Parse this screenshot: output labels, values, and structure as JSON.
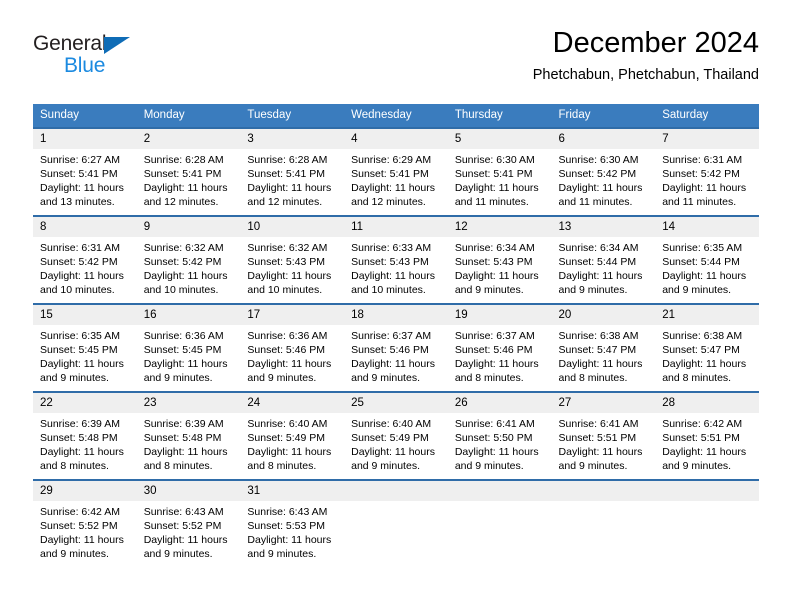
{
  "brand": {
    "name_part1": "General",
    "name_part2": "Blue",
    "accent_color": "#1b8ae0",
    "triangle_color": "#0f6cb6",
    "triangle_icon": "triangle-icon"
  },
  "header": {
    "title": "December 2024",
    "subtitle": "Phetchabun, Phetchabun, Thailand"
  },
  "calendar": {
    "header_color": "#3a7cbe",
    "row_border_color": "#2f6ca8",
    "daynum_background": "#efefef",
    "weekdays": [
      "Sunday",
      "Monday",
      "Tuesday",
      "Wednesday",
      "Thursday",
      "Friday",
      "Saturday"
    ],
    "weeks": [
      [
        {
          "day": "1",
          "sunrise": "Sunrise: 6:27 AM",
          "sunset": "Sunset: 5:41 PM",
          "daylight_line1": "Daylight: 11 hours",
          "daylight_line2": "and 13 minutes."
        },
        {
          "day": "2",
          "sunrise": "Sunrise: 6:28 AM",
          "sunset": "Sunset: 5:41 PM",
          "daylight_line1": "Daylight: 11 hours",
          "daylight_line2": "and 12 minutes."
        },
        {
          "day": "3",
          "sunrise": "Sunrise: 6:28 AM",
          "sunset": "Sunset: 5:41 PM",
          "daylight_line1": "Daylight: 11 hours",
          "daylight_line2": "and 12 minutes."
        },
        {
          "day": "4",
          "sunrise": "Sunrise: 6:29 AM",
          "sunset": "Sunset: 5:41 PM",
          "daylight_line1": "Daylight: 11 hours",
          "daylight_line2": "and 12 minutes."
        },
        {
          "day": "5",
          "sunrise": "Sunrise: 6:30 AM",
          "sunset": "Sunset: 5:41 PM",
          "daylight_line1": "Daylight: 11 hours",
          "daylight_line2": "and 11 minutes."
        },
        {
          "day": "6",
          "sunrise": "Sunrise: 6:30 AM",
          "sunset": "Sunset: 5:42 PM",
          "daylight_line1": "Daylight: 11 hours",
          "daylight_line2": "and 11 minutes."
        },
        {
          "day": "7",
          "sunrise": "Sunrise: 6:31 AM",
          "sunset": "Sunset: 5:42 PM",
          "daylight_line1": "Daylight: 11 hours",
          "daylight_line2": "and 11 minutes."
        }
      ],
      [
        {
          "day": "8",
          "sunrise": "Sunrise: 6:31 AM",
          "sunset": "Sunset: 5:42 PM",
          "daylight_line1": "Daylight: 11 hours",
          "daylight_line2": "and 10 minutes."
        },
        {
          "day": "9",
          "sunrise": "Sunrise: 6:32 AM",
          "sunset": "Sunset: 5:42 PM",
          "daylight_line1": "Daylight: 11 hours",
          "daylight_line2": "and 10 minutes."
        },
        {
          "day": "10",
          "sunrise": "Sunrise: 6:32 AM",
          "sunset": "Sunset: 5:43 PM",
          "daylight_line1": "Daylight: 11 hours",
          "daylight_line2": "and 10 minutes."
        },
        {
          "day": "11",
          "sunrise": "Sunrise: 6:33 AM",
          "sunset": "Sunset: 5:43 PM",
          "daylight_line1": "Daylight: 11 hours",
          "daylight_line2": "and 10 minutes."
        },
        {
          "day": "12",
          "sunrise": "Sunrise: 6:34 AM",
          "sunset": "Sunset: 5:43 PM",
          "daylight_line1": "Daylight: 11 hours",
          "daylight_line2": "and 9 minutes."
        },
        {
          "day": "13",
          "sunrise": "Sunrise: 6:34 AM",
          "sunset": "Sunset: 5:44 PM",
          "daylight_line1": "Daylight: 11 hours",
          "daylight_line2": "and 9 minutes."
        },
        {
          "day": "14",
          "sunrise": "Sunrise: 6:35 AM",
          "sunset": "Sunset: 5:44 PM",
          "daylight_line1": "Daylight: 11 hours",
          "daylight_line2": "and 9 minutes."
        }
      ],
      [
        {
          "day": "15",
          "sunrise": "Sunrise: 6:35 AM",
          "sunset": "Sunset: 5:45 PM",
          "daylight_line1": "Daylight: 11 hours",
          "daylight_line2": "and 9 minutes."
        },
        {
          "day": "16",
          "sunrise": "Sunrise: 6:36 AM",
          "sunset": "Sunset: 5:45 PM",
          "daylight_line1": "Daylight: 11 hours",
          "daylight_line2": "and 9 minutes."
        },
        {
          "day": "17",
          "sunrise": "Sunrise: 6:36 AM",
          "sunset": "Sunset: 5:46 PM",
          "daylight_line1": "Daylight: 11 hours",
          "daylight_line2": "and 9 minutes."
        },
        {
          "day": "18",
          "sunrise": "Sunrise: 6:37 AM",
          "sunset": "Sunset: 5:46 PM",
          "daylight_line1": "Daylight: 11 hours",
          "daylight_line2": "and 9 minutes."
        },
        {
          "day": "19",
          "sunrise": "Sunrise: 6:37 AM",
          "sunset": "Sunset: 5:46 PM",
          "daylight_line1": "Daylight: 11 hours",
          "daylight_line2": "and 8 minutes."
        },
        {
          "day": "20",
          "sunrise": "Sunrise: 6:38 AM",
          "sunset": "Sunset: 5:47 PM",
          "daylight_line1": "Daylight: 11 hours",
          "daylight_line2": "and 8 minutes."
        },
        {
          "day": "21",
          "sunrise": "Sunrise: 6:38 AM",
          "sunset": "Sunset: 5:47 PM",
          "daylight_line1": "Daylight: 11 hours",
          "daylight_line2": "and 8 minutes."
        }
      ],
      [
        {
          "day": "22",
          "sunrise": "Sunrise: 6:39 AM",
          "sunset": "Sunset: 5:48 PM",
          "daylight_line1": "Daylight: 11 hours",
          "daylight_line2": "and 8 minutes."
        },
        {
          "day": "23",
          "sunrise": "Sunrise: 6:39 AM",
          "sunset": "Sunset: 5:48 PM",
          "daylight_line1": "Daylight: 11 hours",
          "daylight_line2": "and 8 minutes."
        },
        {
          "day": "24",
          "sunrise": "Sunrise: 6:40 AM",
          "sunset": "Sunset: 5:49 PM",
          "daylight_line1": "Daylight: 11 hours",
          "daylight_line2": "and 8 minutes."
        },
        {
          "day": "25",
          "sunrise": "Sunrise: 6:40 AM",
          "sunset": "Sunset: 5:49 PM",
          "daylight_line1": "Daylight: 11 hours",
          "daylight_line2": "and 9 minutes."
        },
        {
          "day": "26",
          "sunrise": "Sunrise: 6:41 AM",
          "sunset": "Sunset: 5:50 PM",
          "daylight_line1": "Daylight: 11 hours",
          "daylight_line2": "and 9 minutes."
        },
        {
          "day": "27",
          "sunrise": "Sunrise: 6:41 AM",
          "sunset": "Sunset: 5:51 PM",
          "daylight_line1": "Daylight: 11 hours",
          "daylight_line2": "and 9 minutes."
        },
        {
          "day": "28",
          "sunrise": "Sunrise: 6:42 AM",
          "sunset": "Sunset: 5:51 PM",
          "daylight_line1": "Daylight: 11 hours",
          "daylight_line2": "and 9 minutes."
        }
      ],
      [
        {
          "day": "29",
          "sunrise": "Sunrise: 6:42 AM",
          "sunset": "Sunset: 5:52 PM",
          "daylight_line1": "Daylight: 11 hours",
          "daylight_line2": "and 9 minutes."
        },
        {
          "day": "30",
          "sunrise": "Sunrise: 6:43 AM",
          "sunset": "Sunset: 5:52 PM",
          "daylight_line1": "Daylight: 11 hours",
          "daylight_line2": "and 9 minutes."
        },
        {
          "day": "31",
          "sunrise": "Sunrise: 6:43 AM",
          "sunset": "Sunset: 5:53 PM",
          "daylight_line1": "Daylight: 11 hours",
          "daylight_line2": "and 9 minutes."
        },
        {
          "day": "",
          "sunrise": "",
          "sunset": "",
          "daylight_line1": "",
          "daylight_line2": ""
        },
        {
          "day": "",
          "sunrise": "",
          "sunset": "",
          "daylight_line1": "",
          "daylight_line2": ""
        },
        {
          "day": "",
          "sunrise": "",
          "sunset": "",
          "daylight_line1": "",
          "daylight_line2": ""
        },
        {
          "day": "",
          "sunrise": "",
          "sunset": "",
          "daylight_line1": "",
          "daylight_line2": ""
        }
      ]
    ]
  }
}
